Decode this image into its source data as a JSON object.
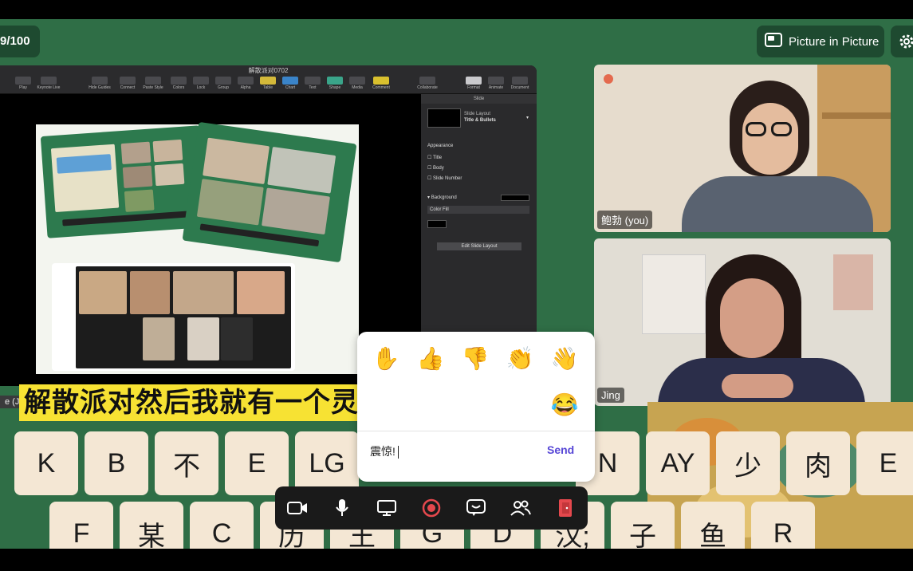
{
  "counter": {
    "text": "9/100"
  },
  "pip": {
    "label": "Picture in Picture"
  },
  "keynote": {
    "title": "解散派对0702",
    "toolbar": [
      "Play",
      "Keynote Live",
      "Hide Guides",
      "Connect",
      "Paste Style",
      "Colors",
      "Lock",
      "Group",
      "Alpha",
      "Table",
      "Chart",
      "Text",
      "Shape",
      "Media",
      "Comment",
      "Collaborate",
      "Format",
      "Animate",
      "Document"
    ],
    "inspector": {
      "tab": "Slide",
      "layout_label": "Slide Layout",
      "layout_value": "Title & Bullets",
      "appearance": "Appearance",
      "options": [
        "Title",
        "Body",
        "Slide Number"
      ],
      "background": "Background",
      "fill": "Color Fill",
      "edit_button": "Edit Slide Layout"
    },
    "left_label": "e (Ji"
  },
  "videos": [
    {
      "name": "鲍勃 (you)"
    },
    {
      "name": "Jing"
    }
  ],
  "caption": "解散派对然后我就有一个灵感想说",
  "reactions": {
    "emojis": [
      "✋",
      "👍",
      "👎",
      "👏",
      "👋",
      "😂"
    ],
    "input_value": "震惊!",
    "send_label": "Send"
  },
  "keyboard": {
    "row1": [
      "K",
      "B",
      "不",
      "E",
      "LG",
      "N",
      "AY",
      "少",
      "肉",
      "E"
    ],
    "row2": [
      "F",
      "某",
      "C",
      "历",
      "王",
      "G",
      "D",
      "汉;",
      "子",
      "鱼",
      "R"
    ]
  },
  "controls": [
    "camera-icon",
    "microphone-icon",
    "screen-share-icon",
    "record-icon",
    "chat-icon",
    "participants-icon",
    "leave-icon"
  ],
  "colors": {
    "stage": "#2f6e46",
    "caption_bg": "#f7e233",
    "send": "#5646d6",
    "record": "#e5484d",
    "leave": "#e5484d"
  }
}
